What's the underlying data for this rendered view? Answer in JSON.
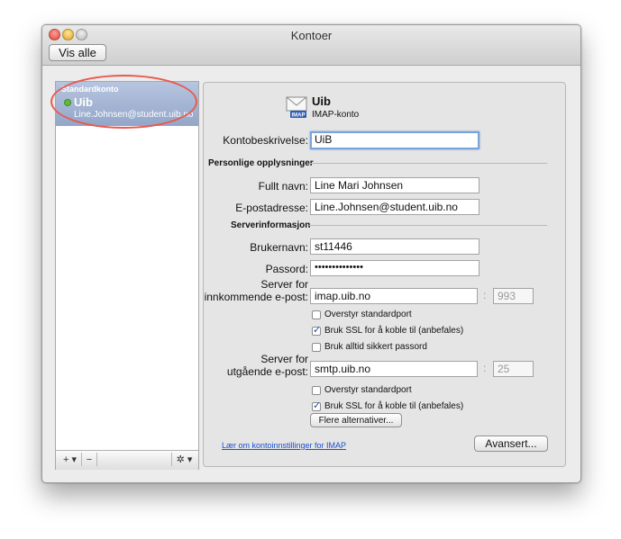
{
  "window": {
    "title": "Kontoer",
    "show_all_label": "Vis alle"
  },
  "sidebar": {
    "group_header": "Standardkonto",
    "account": {
      "name": "Uib",
      "email": "Line.Johnsen@student.uib.no"
    },
    "add_label": "+ ▾",
    "remove_label": "−",
    "action_label": "✲ ▾"
  },
  "account": {
    "title": "Uib",
    "type": "IMAP-konto",
    "icon_badge": "IMAP",
    "description_label": "Kontobeskrivelse:",
    "description_value": "UiB"
  },
  "personal": {
    "header": "Personlige opplysninger",
    "fullname_label": "Fullt navn:",
    "fullname_value": "Line Mari Johnsen",
    "email_label": "E-postadresse:",
    "email_value": "Line.Johnsen@student.uib.no"
  },
  "server": {
    "header": "Serverinformasjon",
    "username_label": "Brukernavn:",
    "username_value": "st11446",
    "password_label": "Passord:",
    "password_value": "••••••••••••••",
    "incoming_label_1": "Server for",
    "incoming_label_2": "innkommende e-post:",
    "incoming_value": "imap.uib.no",
    "incoming_port": "993",
    "override_port_1": "Overstyr standardport",
    "use_ssl_1": "Bruk SSL for å koble til (anbefales)",
    "secure_password": "Bruk alltid sikkert passord",
    "outgoing_label_1": "Server for",
    "outgoing_label_2": "utgående e-post:",
    "outgoing_value": "smtp.uib.no",
    "outgoing_port": "25",
    "override_port_2": "Overstyr standardport",
    "use_ssl_2": "Bruk SSL for å koble til (anbefales)",
    "more_options": "Flere alternativer..."
  },
  "footer": {
    "learn_link": "Lær om kontoinnstillinger for IMAP",
    "advanced_button": "Avansert..."
  },
  "colors": {
    "highlight": "#93a6c9",
    "annotation": "#e85a4f",
    "status_online": "#5bbf35"
  }
}
